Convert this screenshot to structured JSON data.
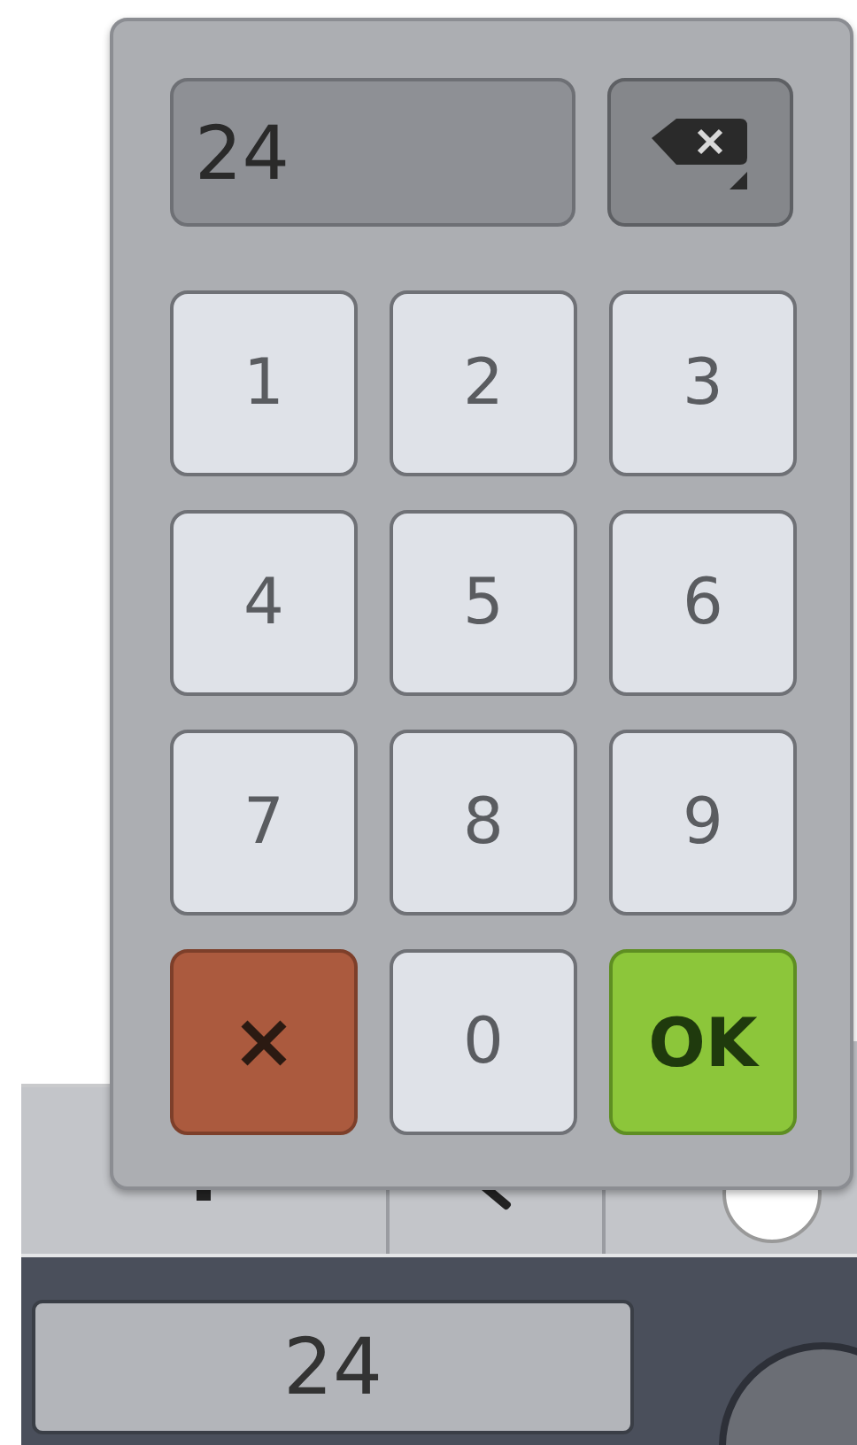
{
  "keypad": {
    "display": {
      "value": "24"
    },
    "keys": [
      {
        "kind": "digit",
        "label": "1"
      },
      {
        "kind": "digit",
        "label": "2"
      },
      {
        "kind": "digit",
        "label": "3"
      },
      {
        "kind": "digit",
        "label": "4"
      },
      {
        "kind": "digit",
        "label": "5"
      },
      {
        "kind": "digit",
        "label": "6"
      },
      {
        "kind": "digit",
        "label": "7"
      },
      {
        "kind": "digit",
        "label": "8"
      },
      {
        "kind": "digit",
        "label": "9"
      },
      {
        "kind": "cancel"
      },
      {
        "kind": "digit",
        "label": "0"
      },
      {
        "kind": "ok",
        "label": "OK"
      }
    ]
  },
  "value_field": {
    "value": "24"
  }
}
